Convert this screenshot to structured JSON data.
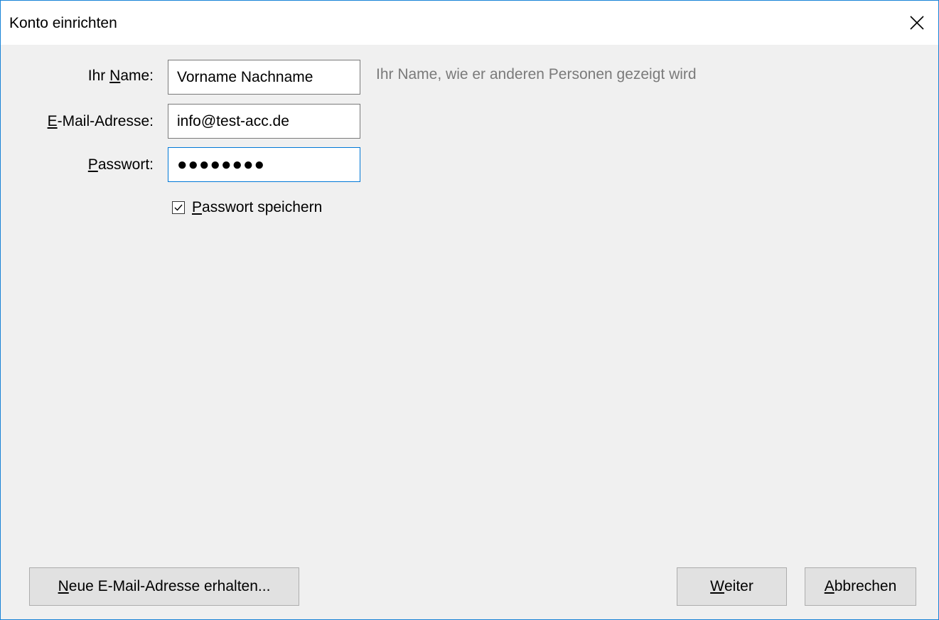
{
  "window": {
    "title": "Konto einrichten",
    "close_icon": "close-icon"
  },
  "form": {
    "name": {
      "label_mnemonic": "N",
      "label_prefix": "Ihr ",
      "label_rest": "ame:",
      "value": "Vorname Nachname",
      "hint": "Ihr Name, wie er anderen Personen gezeigt wird"
    },
    "email": {
      "label_mnemonic": "E",
      "label_rest": "-Mail-Adresse:",
      "value": "info@test-acc.de"
    },
    "password": {
      "label_mnemonic": "P",
      "label_rest": "asswort:",
      "value": "●●●●●●●●"
    },
    "save_password": {
      "checked": true,
      "label_mnemonic": "P",
      "label_rest": "asswort speichern"
    }
  },
  "buttons": {
    "new_address": {
      "mnemonic": "N",
      "rest": "eue E-Mail-Adresse erhalten..."
    },
    "next": {
      "mnemonic": "W",
      "rest": "eiter"
    },
    "cancel": {
      "mnemonic": "A",
      "rest": "bbrechen"
    }
  },
  "colors": {
    "accent": "#0078d7",
    "window_border": "#1883d7",
    "background": "#f0f0f0",
    "hint_text": "#7a7a7a"
  }
}
